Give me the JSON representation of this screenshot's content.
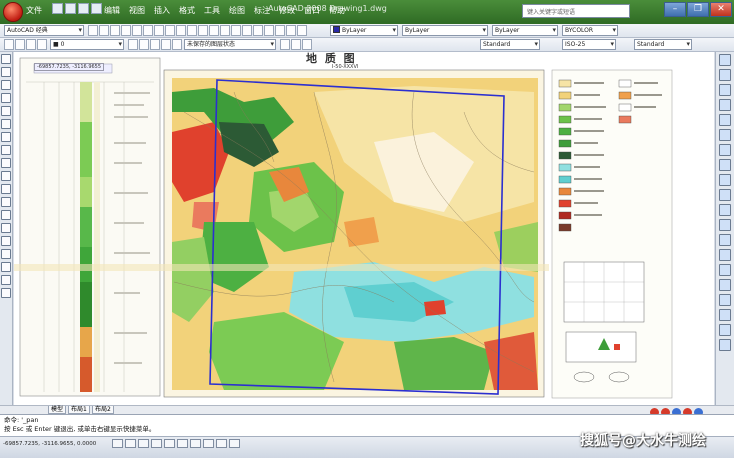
{
  "title_bar": {
    "menu_items": [
      "文件",
      "编辑",
      "视图",
      "插入",
      "格式",
      "工具",
      "绘图",
      "标注",
      "修改",
      "窗口",
      "帮助"
    ],
    "app_title": "AutoCAD 2008  Drawing1.dwg",
    "search_placeholder": "键入关键字或短语",
    "window_controls": [
      "–",
      "❐",
      "✕"
    ]
  },
  "toolbar_row1": {
    "workspace": "AutoCAD 经典",
    "layer": "■ 0",
    "color": "ByLayer",
    "linetype": "ByLayer",
    "lineweight": "ByLayer",
    "plotstyle": "BYCOLOR"
  },
  "toolbar_row2": {
    "layer_state": "未保存的图层状态",
    "text_style": "Standard",
    "dim_style": "ISO-25",
    "table_style": "Standard"
  },
  "drawing": {
    "map_title": "地  质  图",
    "sheet_number": "I-50-XXXVI",
    "coord_tag_left": "-69857.7235, -3116.9655"
  },
  "model_tabs": [
    "模型",
    "布局1",
    "布局2"
  ],
  "command_line": {
    "line1": "命令: '_pan",
    "line2": "按 Esc 或 Enter 键退出, 或单击右键显示快捷菜单。"
  },
  "status_bar": {
    "coordinates": "-69857.7235, -3116.9655, 0.0000"
  },
  "watermark": "搜狐号@大水牛测绘",
  "colors": {
    "title_bar": "#3d7d30",
    "frame_boundary": "#2b2fd0",
    "map_yellow": "#f2d27a",
    "map_red": "#e0412d",
    "map_green": "#6cc24a",
    "map_cyan": "#8fe0e0"
  }
}
